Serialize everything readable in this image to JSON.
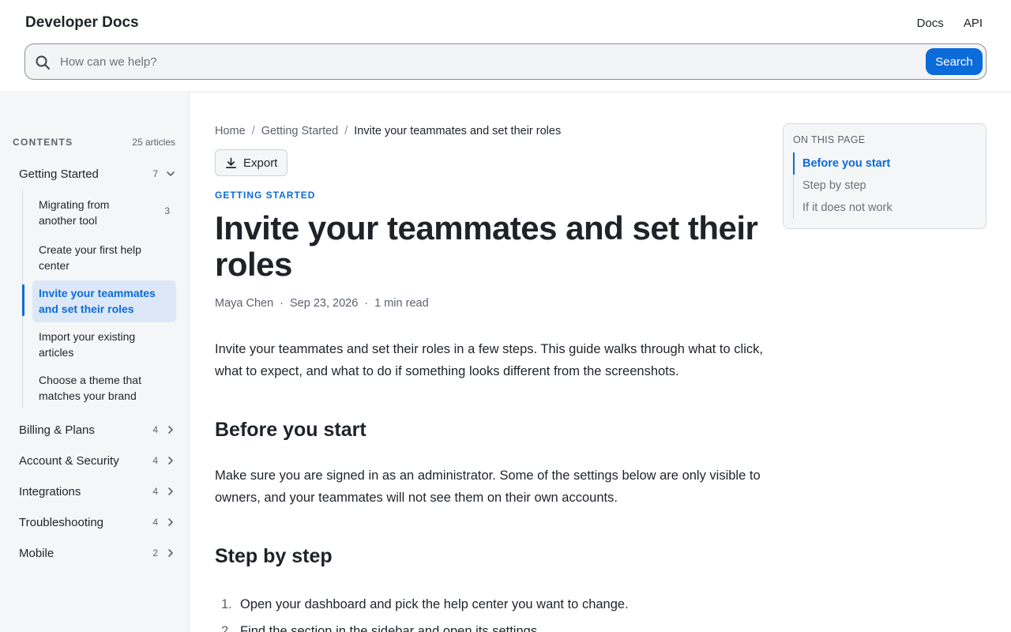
{
  "header": {
    "brand": "Developer Docs",
    "nav": [
      "Docs",
      "API"
    ],
    "search": {
      "placeholder": "How can we help?",
      "button": "Search"
    }
  },
  "sidebar": {
    "label": "CONTENTS",
    "count": "25 articles",
    "sections": [
      {
        "label": "Getting Started",
        "count": "7",
        "expanded": true
      },
      {
        "label": "Billing & Plans",
        "count": "4"
      },
      {
        "label": "Account & Security",
        "count": "4"
      },
      {
        "label": "Integrations",
        "count": "4"
      },
      {
        "label": "Troubleshooting",
        "count": "4"
      },
      {
        "label": "Mobile",
        "count": "2"
      }
    ],
    "sub_items": [
      {
        "label": "Migrating from another tool",
        "count": "3"
      },
      {
        "label": "Create your first help center"
      },
      {
        "label": "Invite your teammates and set their roles",
        "active": true
      },
      {
        "label": "Import your existing articles"
      },
      {
        "label": "Choose a theme that matches your brand"
      }
    ]
  },
  "article": {
    "breadcrumb": [
      "Home",
      "Getting Started",
      "Invite your teammates and set their roles"
    ],
    "export": "Export",
    "eyebrow": "GETTING STARTED",
    "title": "Invite your teammates and set their roles",
    "author": "Maya Chen",
    "date": "Sep 23, 2026",
    "read_time": "1 min read",
    "intro": "Invite your teammates and set their roles in a few steps. This guide walks through what to click, what to expect, and what to do if something looks different from the screenshots.",
    "sections": [
      {
        "heading": "Before you start",
        "body": "Make sure you are signed in as an administrator. Some of the settings below are only visible to owners, and your teammates will not see them on their own accounts."
      },
      {
        "heading": "Step by step"
      }
    ],
    "steps": [
      "Open your dashboard and pick the help center you want to change.",
      "Find the section in the sidebar and open its settings."
    ]
  },
  "toc": {
    "title": "ON THIS PAGE",
    "items": [
      "Before you start",
      "Step by step",
      "If it does not work"
    ],
    "active_index": 0
  },
  "colors": {
    "accent": "#0b6bd8",
    "active_bg": "#dce8f8",
    "sidebar_bg": "#f5f6f8"
  }
}
